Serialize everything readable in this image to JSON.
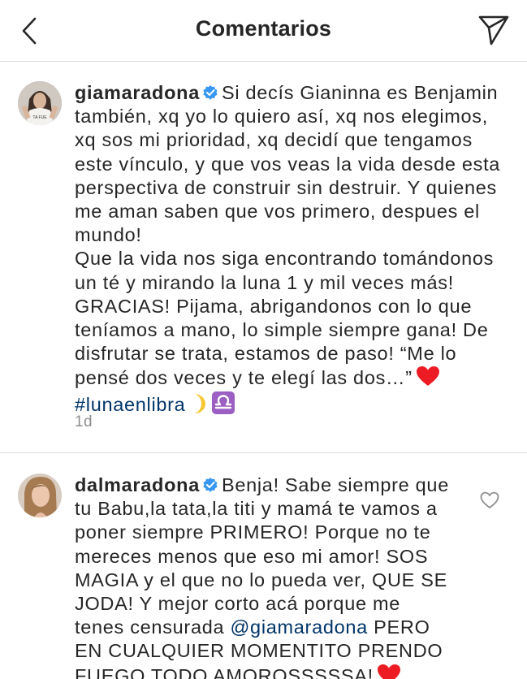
{
  "header": {
    "title": "Comentarios",
    "back_icon": "chevron-left-icon",
    "share_icon": "paper-plane-icon"
  },
  "colors": {
    "text": "#262626",
    "secondary": "#8e8e8e",
    "link": "#003569",
    "verified": "#3897f0",
    "heart": "#ed1c24",
    "divider": "#dbdbdb"
  },
  "comments": [
    {
      "username": "giamaradona",
      "verified": true,
      "lines": [
        "Si decís Gianinna es Benjamin",
        "también, xq yo lo quiero así, xq nos elegimos,",
        "xq sos mi prioridad, xq decidí que tengamos",
        "este vínculo, y que vos veas la vida desde esta",
        "perspectiva de construir sin destruir. Y quienes",
        "me aman saben que vos primero, despues el",
        "mundo!",
        "Que la vida nos siga encontrando tomándonos",
        "un té y mirando la luna 1 y mil veces más!",
        "GRACIAS! Pijama, abrigandonos con lo que",
        "teníamos a mano, lo simple siempre gana! De",
        "disfrutar se trata, estamos de paso! “Me lo",
        "pensé dos veces y te elegí las dos…”"
      ],
      "hashtag": "#lunaenlibra",
      "timestamp": "1d"
    },
    {
      "username": "dalmaradona",
      "verified": true,
      "lines": [
        "Benja! Sabe siempre que",
        "tu Babu,la tata,la titi y mamá te vamos a",
        "poner siempre PRIMERO! Porque no te",
        "mereces menos que eso mi amor! SOS",
        "MAGIA y el que no lo pueda ver, QUE SE",
        "JODA! Y mejor corto acá porque me"
      ],
      "mention_prefix": "tenes censurada ",
      "mention": "@giamaradona",
      "mention_suffix": " PERO",
      "lines_after": [
        "EN CUALQUIER MOMENTITO PRENDO",
        "FUEGO TODO AMOROSSSSSA!"
      ],
      "like_icon": "heart-outline-icon"
    }
  ]
}
